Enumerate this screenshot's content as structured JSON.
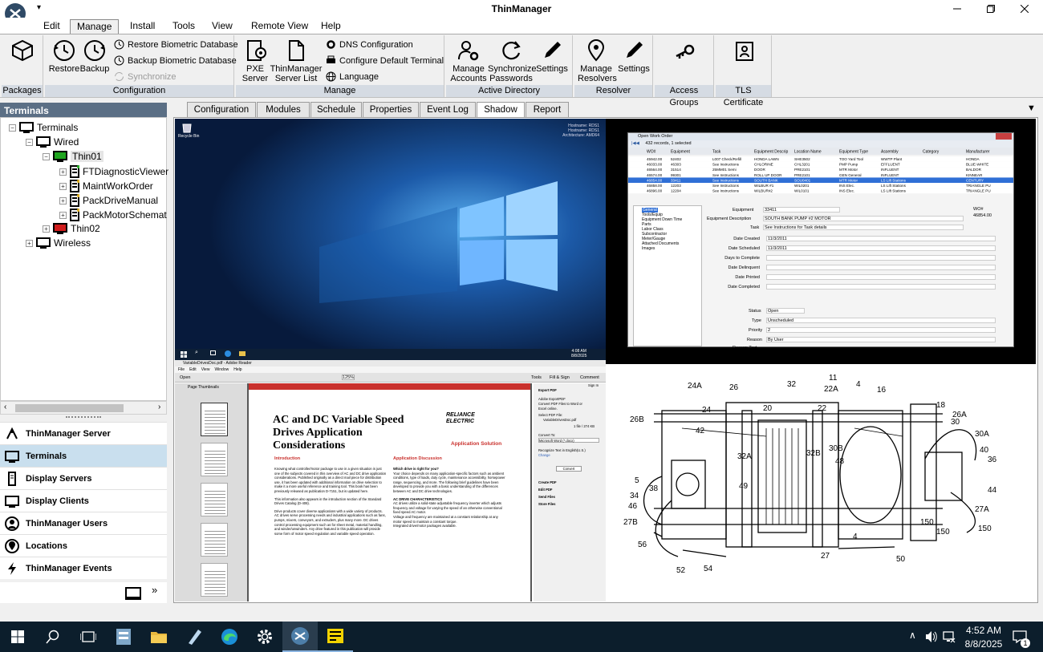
{
  "window": {
    "title": "ThinManager"
  },
  "menu": {
    "items": [
      "Edit",
      "Manage",
      "Install",
      "Tools",
      "View",
      "Remote View",
      "Help"
    ]
  },
  "ribbon": {
    "groups": [
      "Packages",
      "Configuration",
      "Manage",
      "Active Directory",
      "Resolver",
      "Access Groups",
      "TLS Certificate"
    ],
    "restore": "Restore",
    "backup": "Backup",
    "restore_bio": "Restore Biometric Database",
    "backup_bio": "Backup Biometric Database",
    "synchronize": "Synchronize",
    "pxe1": "PXE",
    "pxe2": "Server",
    "tm1": "ThinManager",
    "tm2": "Server List",
    "dns": "DNS Configuration",
    "cfg_terminal": "Configure Default Terminal",
    "language": "Language",
    "ma1": "Manage",
    "ma2": "Accounts",
    "sp1": "Synchronize",
    "sp2": "Passwords",
    "settings": "Settings",
    "mr1": "Manage",
    "mr2": "Resolvers",
    "settings2": "Settings"
  },
  "panel": {
    "title": "Terminals"
  },
  "tree": {
    "root": "Terminals",
    "wired": "Wired",
    "thin01": "Thin01",
    "apps": [
      "FTDiagnosticViewer",
      "MaintWorkOrder",
      "PackDriveManual",
      "PackMotorSchemat"
    ],
    "thin02": "Thin02",
    "wireless": "Wireless"
  },
  "nav": [
    "ThinManager Server",
    "Terminals",
    "Display Servers",
    "Display Clients",
    "ThinManager Users",
    "Locations",
    "ThinManager Events"
  ],
  "tabs": [
    "Configuration",
    "Modules",
    "Schedule",
    "Properties",
    "Event Log",
    "Shadow",
    "Report"
  ],
  "desktop": {
    "recycle": "Recycle Bin",
    "info1": "Hostname: RDS1",
    "info2": "Hostname: RDS1",
    "info3": "Architecture: AMD64",
    "time": "4:08 AM",
    "date": "8/8/2025"
  },
  "workorder": {
    "title": "Open Work Order",
    "records": "432 records, 1 selected",
    "columns": [
      "WO#",
      "Equipment",
      "Task",
      "Equipment Descrip",
      "Location Name",
      "Equipment Type",
      "Assembly",
      "Category",
      "Manufacturer"
    ],
    "rows": [
      [
        "45942.00",
        "52402",
        "L007 Check/Refill",
        "HONDA LAWN",
        "SHE3502",
        "TOO Yard Tool",
        "WWTP Plant",
        "",
        "HONDA"
      ],
      [
        "46033.00",
        "46303",
        "See Instructions",
        "CHLORINE",
        "CHL3201",
        "PMP Pump",
        "EFFLUENT",
        "",
        "BLUE-WHITE"
      ],
      [
        "46564.00",
        "31514",
        "25MM01 Semi",
        "DOOR",
        "PRE2101",
        "MTR Motor",
        "INFLUENT",
        "",
        "BALDOR"
      ],
      [
        "46574.00",
        "99301",
        "See Instructions",
        "ROLL UP DOOR",
        "PRE2101",
        "GEN General",
        "INFLUENT",
        "",
        "KINNEAR"
      ],
      [
        "46854.00",
        "33411",
        "See Instructions",
        "SOUTH BANK",
        "SOU0401",
        "MTR Motor",
        "LS Lift Stations",
        "",
        "CENTURY"
      ],
      [
        "46858.00",
        "12203",
        "See Instructions",
        "WILBUR #1",
        "WIL0201",
        "INS Elec.",
        "LS Lift Stations",
        "",
        "TRIANGLE PU"
      ],
      [
        "46896.00",
        "12204",
        "See Instructions",
        "WILBUR#2",
        "WIL0101",
        "INS Elec.",
        "LS Lift Stations",
        "",
        "TRIANGLE PU"
      ]
    ],
    "menu": [
      "General",
      "Tools/Equip",
      "Equipment Down Time",
      "Parts",
      "Labor Class",
      "Subcontractor",
      "Meter/Gauge",
      "Attached Documents",
      "Images"
    ],
    "equipment_label": "Equipment",
    "equipment": "33411",
    "wo_label": "WO#",
    "wo": "46854.00",
    "desc_label": "Equipment Description",
    "desc": "SOUTH BANK PUMP #2 MOTOR",
    "task_label": "Task",
    "task": "See Instructions for Task details",
    "fields": [
      [
        "Date Created",
        "11/3/2011"
      ],
      [
        "Date Scheduled",
        "11/3/2011"
      ],
      [
        "Days to Complete",
        ""
      ],
      [
        "Date Delinquent",
        ""
      ],
      [
        "Date Printed",
        ""
      ],
      [
        "Date Completed",
        ""
      ]
    ],
    "status_label": "Status",
    "status": "Open",
    "type_label": "Type",
    "type": "Unscheduled",
    "priority_label": "Priority",
    "priority": "2",
    "reason_label": "Reason",
    "reason": "By User",
    "reason_text_label": "Reason Text"
  },
  "pdf": {
    "window_title": "VariableDrivesDoc.pdf - Adobe Reader",
    "menus": [
      "File",
      "Edit",
      "View",
      "Window",
      "Help"
    ],
    "open": "Open",
    "zoom": "125%",
    "tools": "Tools",
    "fill": "Fill & Sign",
    "comment": "Comment",
    "signin": "Sign In",
    "thumb_title": "Page Thumbnails",
    "title1": "AC and DC Variable Speed",
    "title2": "Drives Application",
    "title3": "Considerations",
    "brand1": "RELIANCE",
    "brand2": "ELECTRIC",
    "app_solution": "Application Solution",
    "intro_head": "Introduction",
    "disc_head": "Application Discussion",
    "intro1": "Knowing what controller/motor package to use in a given situation is just one of the subjects covered in this overview of AC and DC drive application considerations. Published originally as a direct mail piece for distribution use, it has been updated with additional information on drive selection to make it a more useful reference and training tool. This book has been previously released as publication D-7151, but is updated here.",
    "intro2": "This information also appears in the introduction section of the Standard Drives Catalog (D-408).",
    "intro3": "Drive products cover diverse applications with a wide variety of products. AC drives serve processing needs and industrial applications such as fans, pumps, mixers, conveyors, and extruders, plus many more. DC drives control processing equipment such as for sheet metal, material handling, and winder/unwinders. Any drive featured in this publication will provide some form of motor speed regulation and variable speed operation.",
    "disc_q": "Which drive is right for you?",
    "disc1": "Your choice depends on many application-specific factors such as ambient conditions, type of loads, duty cycle, maintenance accessibility, horsepower range, sequencing, and more. The following brief guidelines have been developed to provide you with a basic understanding of the differences between AC and DC drive technologies.",
    "ac_head": "AC DRIVE CHARACTERISTICS",
    "ac1": "AC drives utilize a solid-state adjustable frequency inverter which adjusts frequency and voltage for varying the speed of an otherwise conventional fixed speed AC motor.",
    "ac2": "Voltage and frequency are maintained at a constant relationship at any motor speed to maintain a constant torque.",
    "ac3": "Integrated drive/motor packages available.",
    "export_head": "Export PDF",
    "export_sub": "Adobe ExportPDF",
    "export_desc": "Convert PDF Files to Word or Excel online.",
    "select_file": "Select PDF File:",
    "file": "VariableDrivesDoc.pdf",
    "file_count": "1 file / 274 KB",
    "convert_to": "Convert To:",
    "convert_opt": "Microsoft Word (*.docx)",
    "recognize": "Recognize Text in English(U.S.)",
    "change": "Change",
    "convert_btn": "Convert",
    "sections": [
      "Create PDF",
      "Edit PDF",
      "Send Files",
      "Store Files"
    ]
  },
  "drawing": {
    "labels": [
      "24A",
      "26",
      "32",
      "22A",
      "11",
      "4",
      "16",
      "18",
      "26A",
      "30",
      "30A",
      "26B",
      "24",
      "20",
      "22",
      "42",
      "40",
      "36",
      "32A",
      "32B",
      "30B",
      "48",
      "5",
      "44",
      "38",
      "49",
      "34",
      "46",
      "27A",
      "27B",
      "150",
      "150",
      "150",
      "56",
      "4",
      "27",
      "50",
      "52",
      "54"
    ]
  },
  "taskbar": {
    "time": "4:52 AM",
    "date": "8/8/2025",
    "notif_count": "1"
  },
  "colors": {
    "ribbon_group_label": "#d5dbe3",
    "panel_header": "#5b6f85",
    "selected_nav": "#c9dfee",
    "taskbar": "#0c1e2c",
    "pdf_red": "#c9302c"
  }
}
